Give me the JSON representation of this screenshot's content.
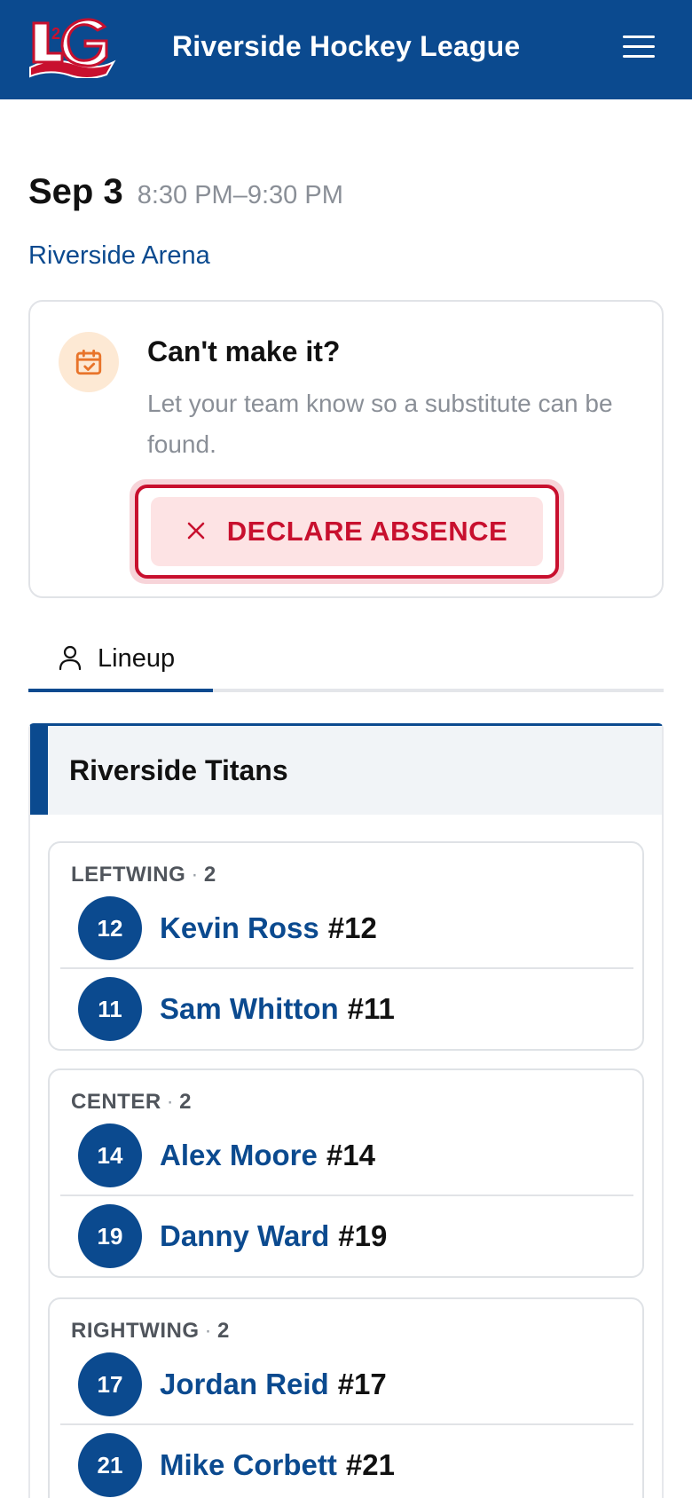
{
  "header": {
    "logo_text": "L2G",
    "title": "Riverside Hockey League",
    "menu_icon": "hamburger-menu-icon"
  },
  "event": {
    "date": "Sep 3",
    "time": "8:30 PM–9:30 PM",
    "venue": "Riverside Arena"
  },
  "absence": {
    "icon": "calendar-check-icon",
    "title": "Can't make it?",
    "description": "Let your team know so a substitute can be found.",
    "button_label": "DECLARE ABSENCE",
    "button_icon": "close-icon"
  },
  "tabs": [
    {
      "label": "Lineup",
      "icon": "person-icon",
      "active": true
    }
  ],
  "team": {
    "name": "Riverside Titans",
    "accent": "#0b4a8f",
    "positions": [
      {
        "name": "LEFTWING",
        "count": "2",
        "players": [
          {
            "badge": "12",
            "name": "Kevin Ross",
            "number": "#12"
          },
          {
            "badge": "11",
            "name": "Sam Whitton",
            "number": "#11"
          }
        ]
      },
      {
        "name": "CENTER",
        "count": "2",
        "players": [
          {
            "badge": "14",
            "name": "Alex Moore",
            "number": "#14"
          },
          {
            "badge": "19",
            "name": "Danny Ward",
            "number": "#19"
          }
        ]
      },
      {
        "name": "RIGHTWING",
        "count": "2",
        "players": [
          {
            "badge": "17",
            "name": "Jordan Reid",
            "number": "#17"
          },
          {
            "badge": "21",
            "name": "Mike Corbett",
            "number": "#21"
          }
        ]
      }
    ]
  },
  "colors": {
    "primary": "#0b4a8f",
    "danger": "#c8102e",
    "danger_bg": "#fde3e4",
    "calendar_bg": "#fde9d4",
    "calendar_icon": "#e8742a"
  }
}
